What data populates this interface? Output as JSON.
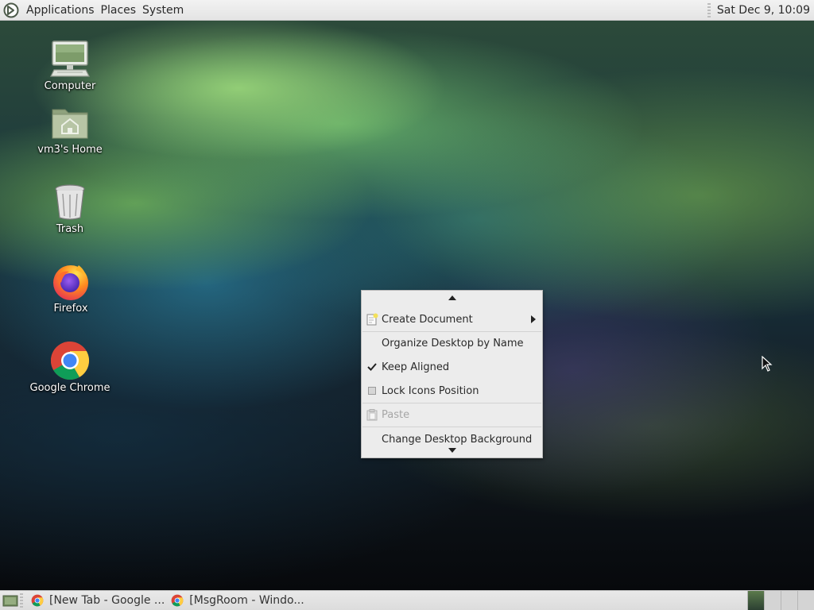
{
  "top_panel": {
    "menus": [
      "Applications",
      "Places",
      "System"
    ],
    "clock": "Sat Dec  9, 10:09"
  },
  "desktop_icons": [
    {
      "label": "Computer",
      "icon": "computer-icon"
    },
    {
      "label": "vm3's Home",
      "icon": "home-folder-icon"
    },
    {
      "label": "Trash",
      "icon": "trash-icon"
    },
    {
      "label": "Firefox",
      "icon": "firefox-icon"
    },
    {
      "label": "Google Chrome",
      "icon": "chrome-icon"
    }
  ],
  "context_menu": {
    "items": [
      {
        "label": "Create Document",
        "icon": "new-document-icon",
        "submenu": true
      },
      {
        "label": "Organize Desktop by Name"
      },
      {
        "label": "Keep Aligned",
        "checked": true
      },
      {
        "label": "Lock Icons Position",
        "checked": false
      },
      {
        "label": "Paste",
        "icon": "paste-icon",
        "disabled": true
      },
      {
        "label": "Change Desktop Background"
      }
    ]
  },
  "taskbar": {
    "tasks": [
      {
        "label": "[New Tab - Google ...",
        "icon": "chrome-icon"
      },
      {
        "label": "[MsgRoom - Windo...",
        "icon": "chrome-icon"
      }
    ],
    "workspaces": 4,
    "active_workspace": 1
  },
  "colors": {
    "panel_bg": "#e6e6e6",
    "menu_bg": "#ececec",
    "accent_green": "#5b7a4c"
  }
}
